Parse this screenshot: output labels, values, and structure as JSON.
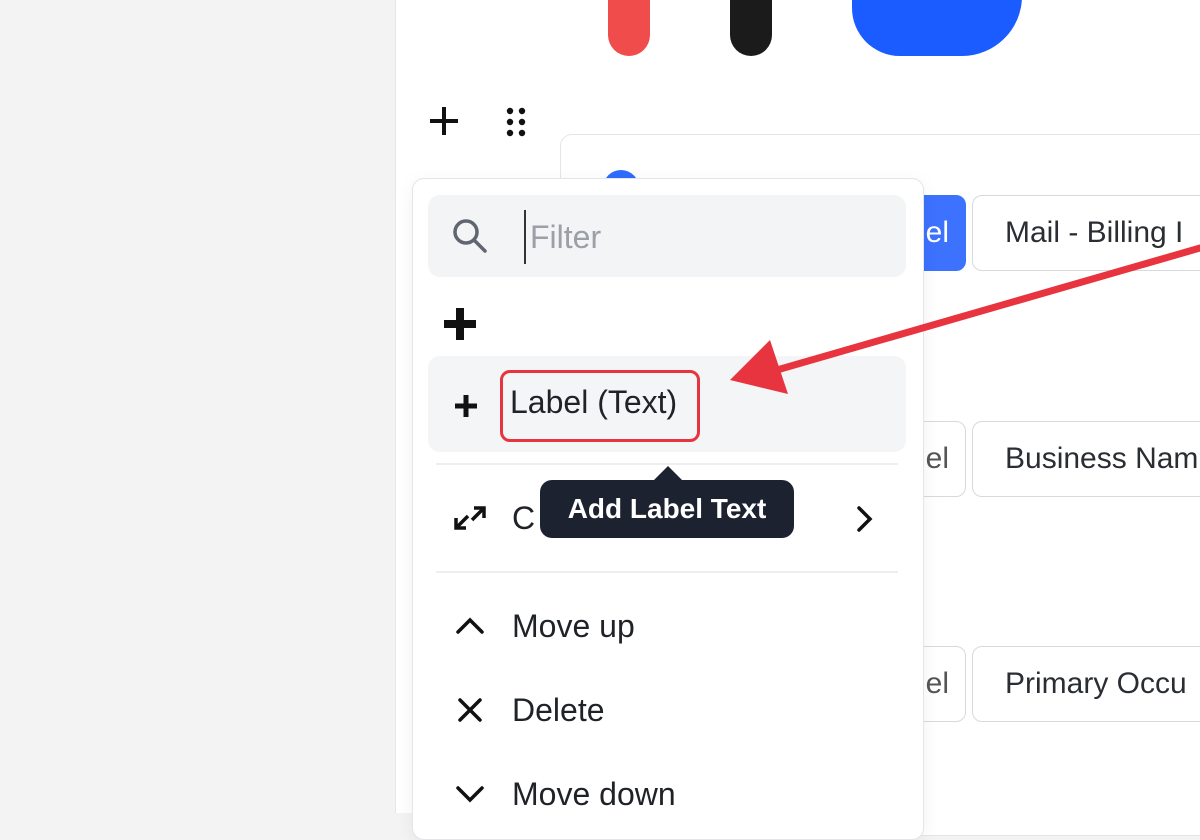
{
  "search": {
    "placeholder": "Filter"
  },
  "menu": {
    "add_item_label": "Label (Text)",
    "tooltip": "Add Label Text",
    "convert_label": "C",
    "move_up": "Move up",
    "delete": "Delete",
    "move_down": "Move down"
  },
  "fields": [
    {
      "chip_label": "el",
      "value": "Mail - Billing I"
    },
    {
      "chip_label": "el",
      "value": "Business Nam"
    },
    {
      "chip_label": "el",
      "value": "Primary Occu"
    }
  ],
  "colors": {
    "accent": "#3d72ff",
    "highlight_box": "#e8343f",
    "tooltip_bg": "#1d2230"
  }
}
